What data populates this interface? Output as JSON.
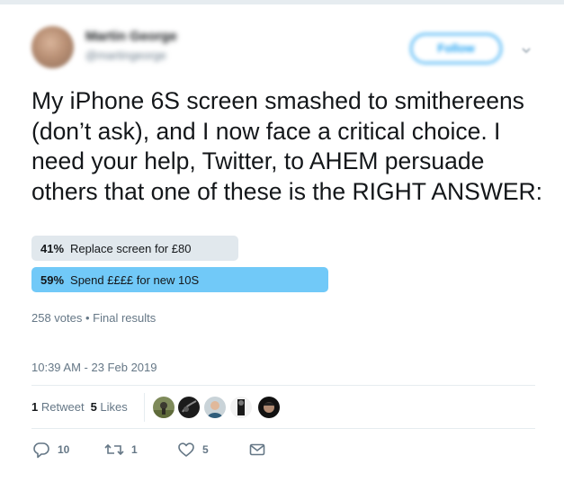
{
  "author": {
    "name": "Martin George",
    "handle": "@martingeorge",
    "follow_label": "Follow"
  },
  "tweet": {
    "text": "My iPhone 6S screen smashed to smithereens (don’t ask), and I now face a critical choice. I need your help, Twitter, to AHEM persuade others that one of these is the RIGHT ANSWER:"
  },
  "poll": {
    "options": [
      {
        "percent_label": "41%",
        "fraction": 0.41,
        "label": "Replace screen for £80",
        "winner": false
      },
      {
        "percent_label": "59%",
        "fraction": 0.59,
        "label": "Spend ££££ for new 10S",
        "winner": true
      }
    ],
    "meta": "258 votes • Final results"
  },
  "timestamp": "10:39 AM - 23 Feb 2019",
  "stats": {
    "retweets_count": "1",
    "retweets_label": "Retweet",
    "likes_count": "5",
    "likes_label": "Likes"
  },
  "actions": {
    "replies": "10",
    "retweets": "1",
    "likes": "5"
  },
  "icons": {
    "reply": "reply-icon",
    "retweet": "retweet-icon",
    "like": "heart-icon",
    "message": "envelope-icon",
    "more": "chevron-down-icon"
  },
  "colors": {
    "accent": "#1da1f2",
    "winner_bar": "#71c9f8",
    "loser_bar": "#e1e8ed",
    "secondary_text": "#657786"
  }
}
